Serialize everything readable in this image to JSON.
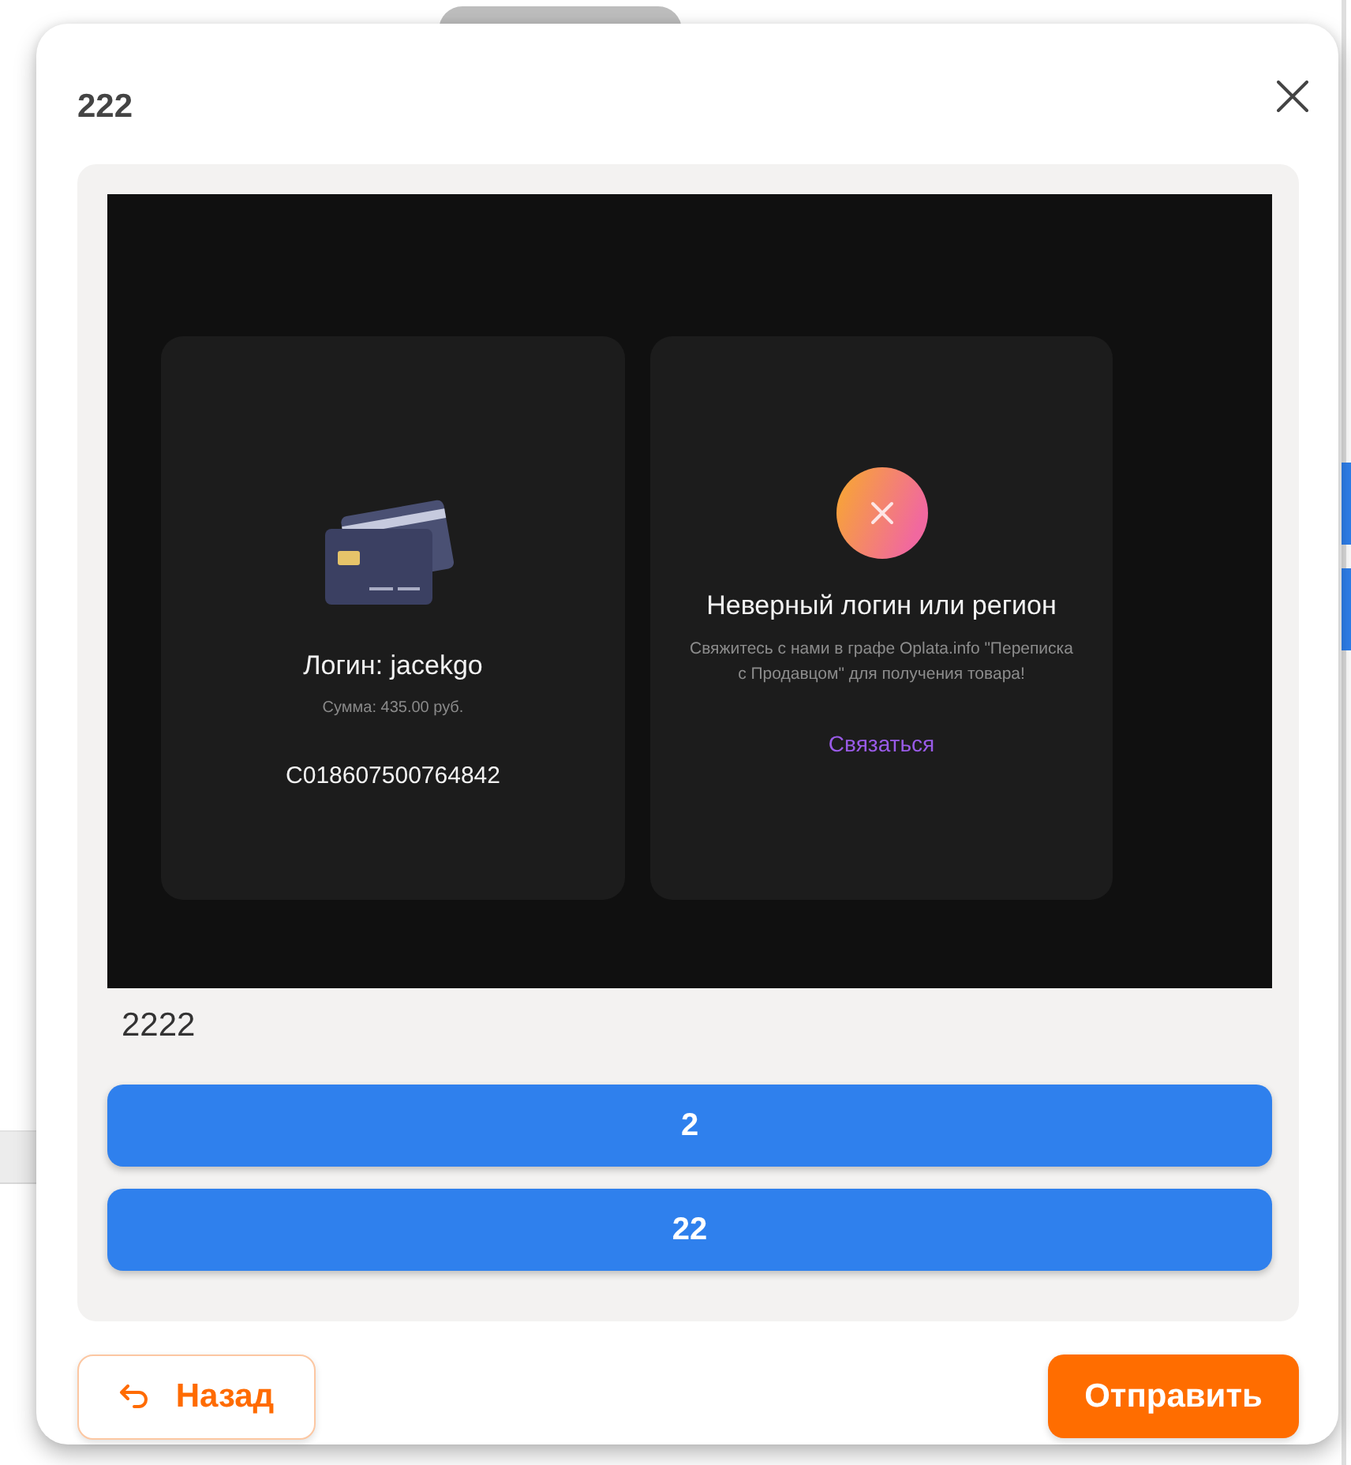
{
  "dialog": {
    "title": "222"
  },
  "embedded_screenshot": {
    "cards": [
      {
        "kind": "receipt",
        "login": "Логин: jacekgo",
        "amount": "Сумма: 435.00 руб.",
        "code": "C018607500764842"
      },
      {
        "kind": "error",
        "heading": "Неверный логин или регион",
        "message": "Свяжитесь с нами в графе Oplata.info \"Переписка с Продавцом\" для получения товара!",
        "link": "Связаться"
      }
    ]
  },
  "caption": "2222",
  "options": [
    {
      "label": "2"
    },
    {
      "label": "22"
    }
  ],
  "footer": {
    "back": "Назад",
    "submit": "Отправить"
  }
}
